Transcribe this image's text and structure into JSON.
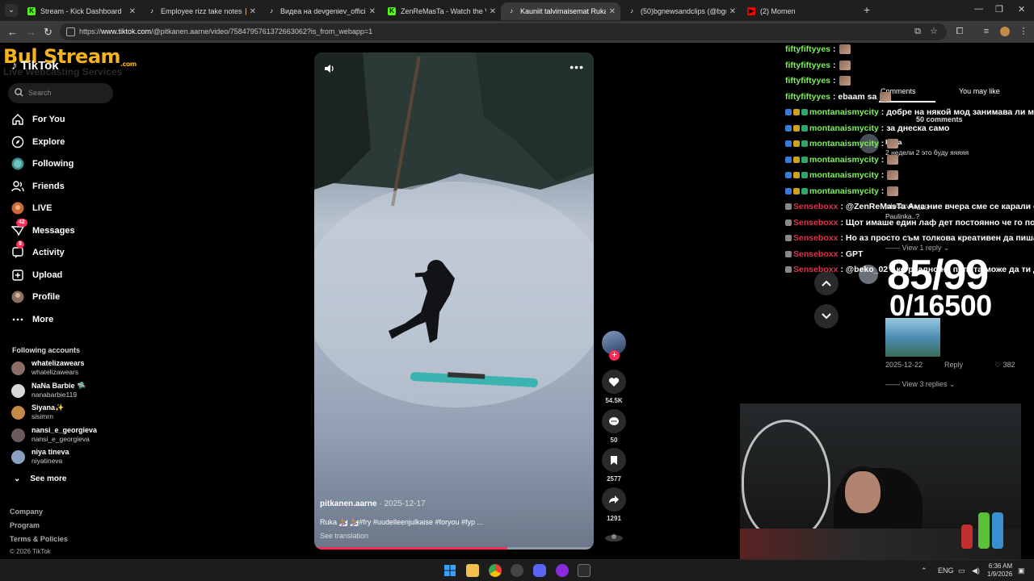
{
  "browser": {
    "tabs": [
      {
        "title": "Stream - Kick Dashboard",
        "favicon": "kick-icon",
        "color": "#53fc18",
        "active": false
      },
      {
        "title": "Employee rizz take notes 📋 #a",
        "favicon": "tiktok-icon",
        "color": "#ffffff",
        "active": false
      },
      {
        "title": "Видеа на devgeniev_official (@",
        "favicon": "tiktok-icon",
        "color": "#ffffff",
        "active": false
      },
      {
        "title": "ZenReMasTa - Watch the VOD",
        "favicon": "kick-icon",
        "color": "#53fc18",
        "active": false
      },
      {
        "title": "Kauniit talvimaisemat Ruka❄️❄️",
        "favicon": "tiktok-icon",
        "color": "#ffffff",
        "active": true
      },
      {
        "title": "(50)bgnewsandclips (@bgnew",
        "favicon": "tiktok-icon",
        "color": "#ffffff",
        "active": false
      },
      {
        "title": "(2) Momen",
        "favicon": "youtube-icon",
        "color": "#ff0000",
        "active": false
      }
    ],
    "url_prefix": "https://",
    "url_host": "www.tiktok.com",
    "url_path": "/@pitkanen.aarne/video/7584795761372663062?is_from_webapp=1"
  },
  "watermark": {
    "brand": "Bul Stream",
    "brand_com": ".com",
    "subtitle": "Live Webcasting Services"
  },
  "sidebar": {
    "logo": "TikTok",
    "search_placeholder": "Search",
    "nav": [
      {
        "label": "For You",
        "icon": "home-icon"
      },
      {
        "label": "Explore",
        "icon": "compass-icon"
      },
      {
        "label": "Following",
        "icon": "following-avatar-icon"
      },
      {
        "label": "Friends",
        "icon": "friends-icon"
      },
      {
        "label": "LIVE",
        "icon": "live-icon"
      },
      {
        "label": "Messages",
        "icon": "messages-icon",
        "badge": "42"
      },
      {
        "label": "Activity",
        "icon": "activity-icon",
        "badge": "8"
      },
      {
        "label": "Upload",
        "icon": "upload-icon"
      },
      {
        "label": "Profile",
        "icon": "profile-icon"
      },
      {
        "label": "More",
        "icon": "more-icon"
      }
    ],
    "following_header": "Following accounts",
    "accounts": [
      {
        "name": "whatelizawears",
        "handle": "whatelizawears",
        "color": "#8a6e66"
      },
      {
        "name": "NaNa Barbie 🛸",
        "handle": "nanabarbie119",
        "color": "#d8d8d8"
      },
      {
        "name": "Siyana✨",
        "handle": "sisimrn",
        "color": "#c48a4a"
      },
      {
        "name": "nansi_e_georgieva",
        "handle": "nansi_e_georgieva",
        "color": "#6c5a5a"
      },
      {
        "name": "niya tineva",
        "handle": "niyatineva",
        "color": "#8aa0c0"
      }
    ],
    "see_more": "See more",
    "footer": {
      "company": "Company",
      "program": "Program",
      "terms": "Terms & Policies",
      "copyright": "© 2026 TikTok"
    }
  },
  "video": {
    "author": "pitkanen.aarne",
    "date": " · 2025-12-17",
    "caption": "Ruka 🏂 🏂#fry #uudelleenjulkaise #foryou #fyp ...",
    "see_translation": "See translation",
    "progress_fraction": 0.69
  },
  "actions": {
    "likes": "54.5K",
    "comments": "50",
    "saves": "2577",
    "shares": "1291"
  },
  "comments_panel": {
    "tab_comments": "Comments",
    "tab_you_may_like": "You may like",
    "count": "50 comments",
    "comment1_name": "Кира",
    "comment1_text": "2 недели 2 это буду яяяяя",
    "comment2_text": "juleczxvka_gg",
    "comment3_text": "Paulinka..?",
    "view_1_reply": "View 1 reply",
    "date": "2025-12-22",
    "reply": "Reply",
    "likes": "382",
    "view_3_replies": "View 3 replies"
  },
  "overlay_counter": {
    "big": "85/99",
    "small": "0/16500"
  },
  "chat": [
    {
      "user": "fiftyfiftyyes",
      "msg": ":",
      "color": "g",
      "emote": true,
      "badges": 0
    },
    {
      "user": "fiftyfiftyyes",
      "msg": ":",
      "color": "g",
      "emote": true,
      "badges": 0
    },
    {
      "user": "fiftyfiftyyes",
      "msg": ":",
      "color": "g",
      "emote": true,
      "badges": 0
    },
    {
      "user": "fiftyfiftyyes",
      "msg": ": ebaam sa",
      "color": "g",
      "emote": true,
      "badges": 0
    },
    {
      "user": "montanaismycity",
      "msg": ": добре на някой мод занимава ли му",
      "color": "g",
      "emote": false,
      "badges": 3
    },
    {
      "user": "montanaismycity",
      "msg": ": за днеска само",
      "color": "g",
      "emote": false,
      "badges": 3
    },
    {
      "user": "montanaismycity",
      "msg": ":",
      "color": "g",
      "emote": true,
      "badges": 3
    },
    {
      "user": "montanaismycity",
      "msg": ":",
      "color": "g",
      "emote": true,
      "badges": 3
    },
    {
      "user": "montanaismycity",
      "msg": ":",
      "color": "g",
      "emote": true,
      "badges": 3
    },
    {
      "user": "montanaismycity",
      "msg": ":",
      "color": "g",
      "emote": true,
      "badges": 3
    },
    {
      "user": "Senseboxx",
      "msg": ": @ZenReMasTa Ама ние вчера сме се карали оч",
      "color": "r",
      "emote": false,
      "badges": 1
    },
    {
      "user": "Senseboxx",
      "msg": ": Щот имаше един лаф дет постоянно че го полз",
      "color": "r",
      "emote": false,
      "badges": 1
    },
    {
      "user": "Senseboxx",
      "msg": ": Но аз просто съм толкова креативен да пиша",
      "color": "r",
      "emote": false,
      "badges": 1
    },
    {
      "user": "Senseboxx",
      "msg": ": GPT",
      "color": "r",
      "emote": false,
      "badges": 1
    },
    {
      "user": "Senseboxx",
      "msg": ": @beko_02 Ако реално не попита може да ти да",
      "color": "r",
      "emote": false,
      "badges": 1
    }
  ],
  "taskbar": {
    "lang": "ENG",
    "time": "6:36 AM",
    "date": "1/9/2026"
  }
}
